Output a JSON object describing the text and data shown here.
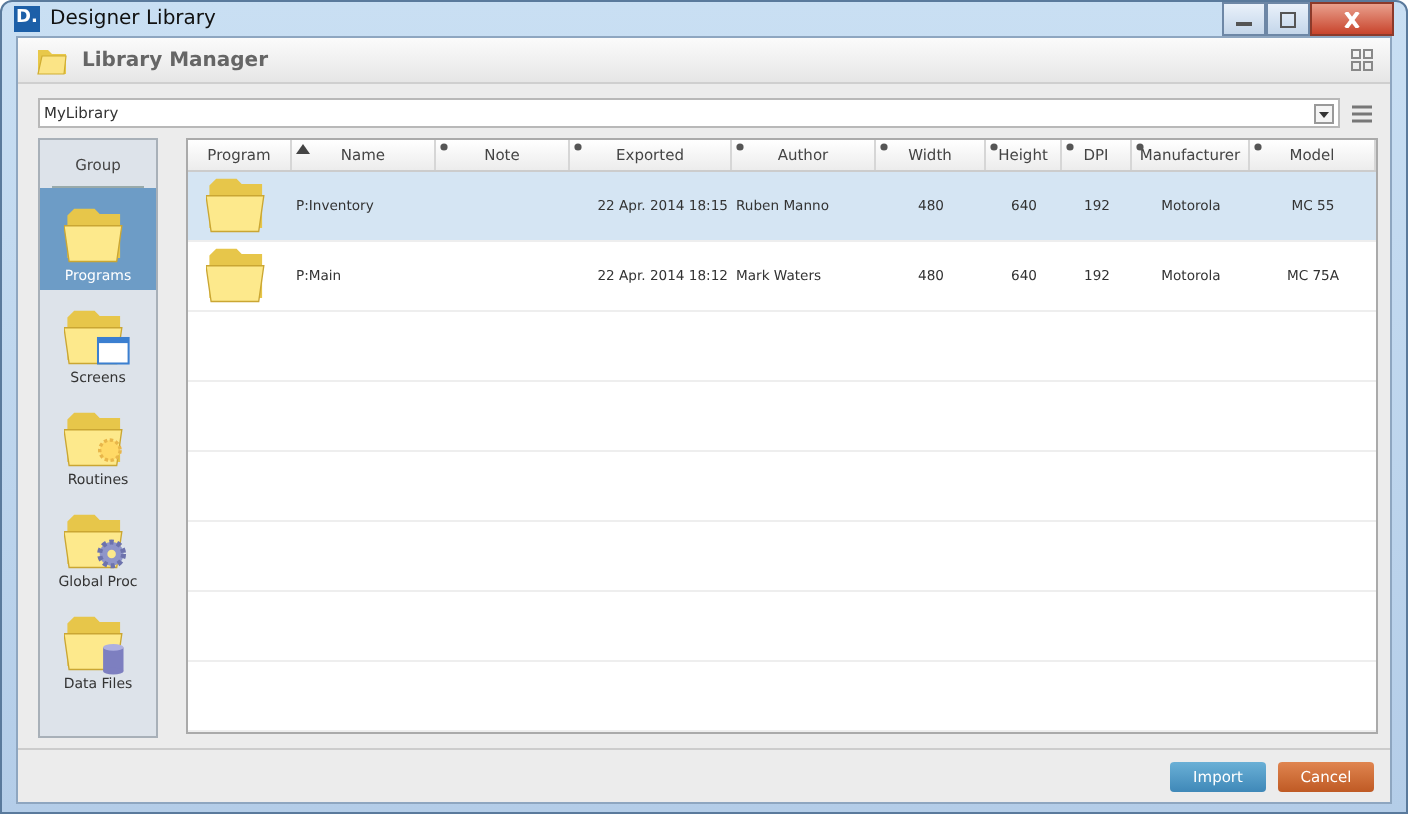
{
  "window": {
    "title": "Designer Library",
    "logo": "D."
  },
  "header": {
    "title": "Library Manager"
  },
  "library_select": {
    "value": "MyLibrary"
  },
  "sidebar": {
    "heading": "Group",
    "items": [
      {
        "label": "Programs",
        "kind": "folder",
        "selected": true
      },
      {
        "label": "Screens",
        "kind": "window",
        "selected": false
      },
      {
        "label": "Routines",
        "kind": "sun",
        "selected": false
      },
      {
        "label": "Global Proc",
        "kind": "gear",
        "selected": false
      },
      {
        "label": "Data Files",
        "kind": "database",
        "selected": false
      }
    ]
  },
  "table": {
    "columns": [
      {
        "label": "Program"
      },
      {
        "label": "Name",
        "sorted": true
      },
      {
        "label": "Note",
        "sorted": false
      },
      {
        "label": "Exported",
        "sorted": false
      },
      {
        "label": "Author",
        "sorted": false
      },
      {
        "label": "Width",
        "sorted": false
      },
      {
        "label": "Height",
        "sorted": false
      },
      {
        "label": "DPI",
        "sorted": false
      },
      {
        "label": "Manufacturer",
        "sorted": false
      },
      {
        "label": "Model",
        "sorted": false
      }
    ],
    "rows": [
      {
        "selected": true,
        "cells": [
          "",
          "P:Inventory",
          "",
          "22 Apr. 2014 18:15",
          "Ruben Manno",
          "480",
          "640",
          "192",
          "Motorola",
          "MC 55"
        ]
      },
      {
        "selected": false,
        "cells": [
          "",
          "P:Main",
          "",
          "22 Apr. 2014 18:12",
          "Mark Waters",
          "480",
          "640",
          "192",
          "Motorola",
          "MC 75A"
        ]
      }
    ]
  },
  "buttons": [
    {
      "label": "Import",
      "kind": "primary"
    },
    {
      "label": "Cancel",
      "kind": "danger"
    }
  ]
}
